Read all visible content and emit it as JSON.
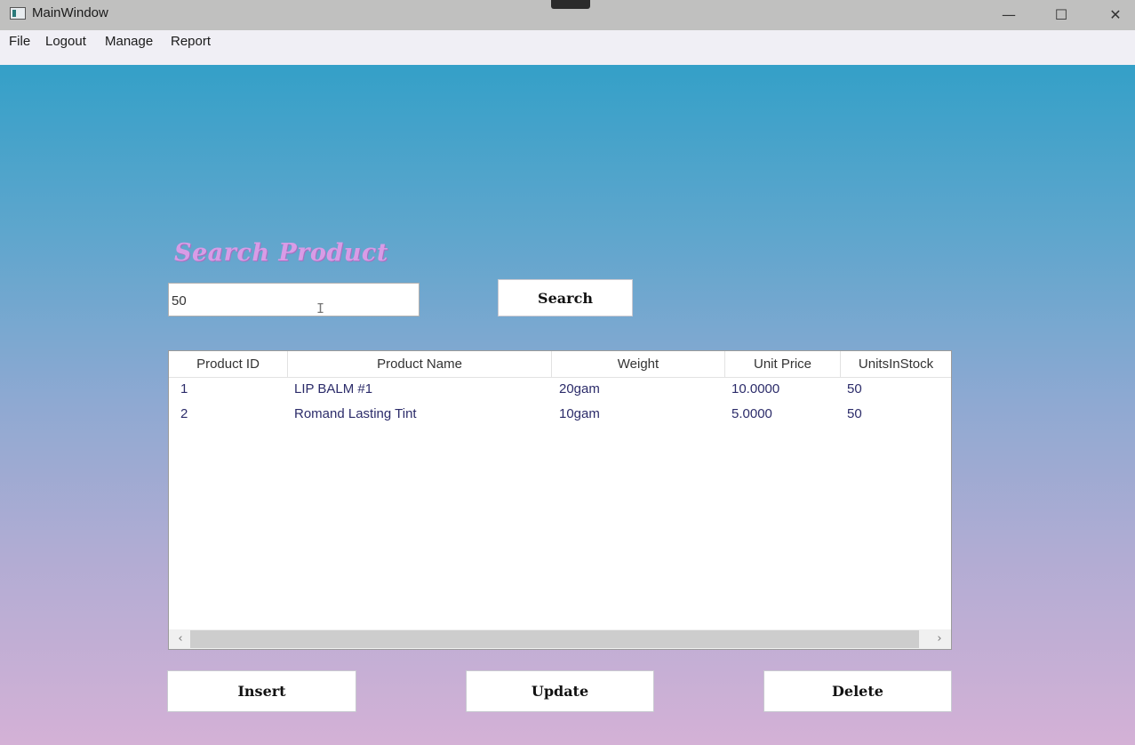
{
  "window": {
    "title": "MainWindow",
    "controls": {
      "minimize": "—",
      "maximize": "☐",
      "close": "✕"
    }
  },
  "menu": {
    "items": [
      "File",
      "Logout",
      "Manage",
      "Report"
    ]
  },
  "search": {
    "heading": "Search Product",
    "value": "50",
    "button_label": "Search"
  },
  "grid": {
    "columns": [
      "Product ID",
      "Product Name",
      "Weight",
      "Unit Price",
      "UnitsInStock"
    ],
    "rows": [
      [
        "1",
        "LIP BALM #1",
        "20gam",
        "10.0000",
        "50"
      ],
      [
        "2",
        "Romand Lasting Tint",
        "10gam",
        "5.0000",
        "50"
      ]
    ]
  },
  "actions": {
    "insert_label": "Insert",
    "update_label": "Update",
    "delete_label": "Delete"
  },
  "colors": {
    "gradient_top": "#34a0c8",
    "gradient_bottom": "#d4b1d6",
    "heading": "#d89ce6"
  }
}
